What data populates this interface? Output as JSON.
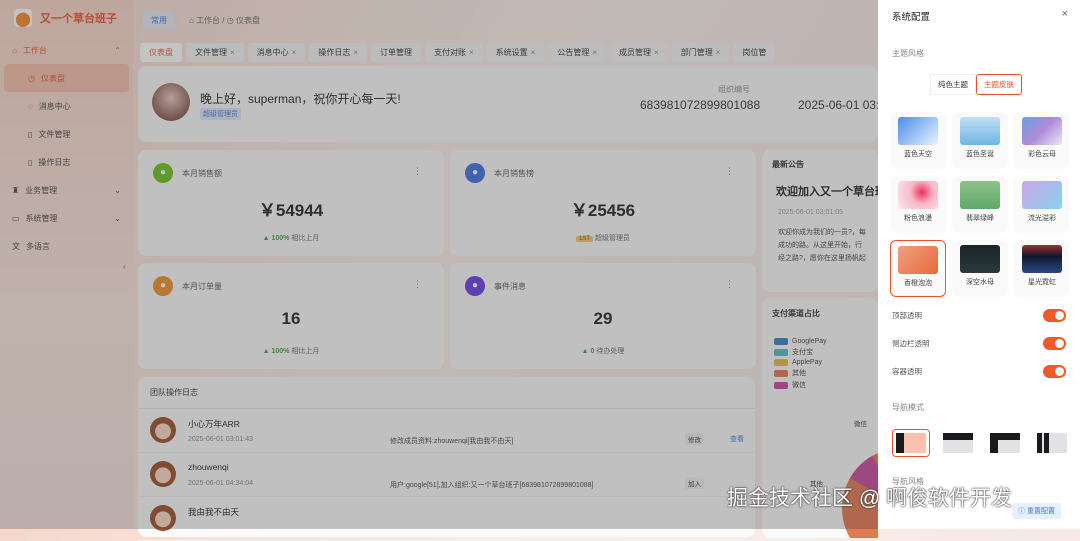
{
  "app": {
    "title": "又一个草台班子"
  },
  "sidebar": {
    "items": [
      {
        "label": "工作台",
        "icon": "home-icon"
      },
      {
        "label": "仪表盘"
      },
      {
        "label": "消息中心"
      },
      {
        "label": "文件管理"
      },
      {
        "label": "操作日志"
      },
      {
        "label": "业务管理"
      },
      {
        "label": "系统管理"
      },
      {
        "label": "多语言"
      }
    ]
  },
  "topbar": {
    "pill": "常用",
    "crumb1": "工作台",
    "sep": "/",
    "crumb2": "仪表盘"
  },
  "tabs": [
    "仪表盘",
    "文件管理",
    "消息中心",
    "操作日志",
    "订单管理",
    "支付对账",
    "系统设置",
    "公告管理",
    "成员管理",
    "部门管理",
    "岗位管"
  ],
  "tab_close": "×",
  "welcome": {
    "greeting": "晚上好，superman，祝你开心每一天!",
    "role": "超级管理员",
    "org_label": "组织编号",
    "org_id": "683981072899801088",
    "date": "2025-06-01 03:0"
  },
  "stats": [
    {
      "label": "本月销售额",
      "value": "￥54944",
      "trend": "▲ 100%",
      "note": "相比上月",
      "color": "#6cc21c"
    },
    {
      "label": "本月销售榜",
      "value": "￥25456",
      "badge": "1ST",
      "note": "超级管理员",
      "color": "#3f6fe0"
    },
    {
      "label": "本月订单量",
      "value": "16",
      "trend": "▲ 100%",
      "note": "相比上月",
      "color": "#f08c2a"
    },
    {
      "label": "事件消息",
      "value": "29",
      "trend": "▲ 0",
      "note": "待办处理",
      "color": "#6a3be0"
    }
  ],
  "more": "⋮",
  "notice": {
    "title": "最新公告",
    "headline": "欢迎加入又一个草台班子",
    "date": "2025-06-01 03:01:05",
    "body": [
      "欢迎你成为我们的一员?，每",
      "成功的路。从这里开始，行",
      "经之路?，愿你在这里扬帆起"
    ]
  },
  "pay": {
    "title": "支付渠道占比",
    "legend": [
      {
        "name": "GooglePay",
        "color": "#3a7fc0"
      },
      {
        "name": "支付宝",
        "color": "#56b9c8"
      },
      {
        "name": "ApplePay",
        "color": "#e6bc3a"
      },
      {
        "name": "其他",
        "color": "#e07850"
      },
      {
        "name": "微信",
        "color": "#c44a9a"
      }
    ],
    "label_wx": "微信",
    "label_other": "其他"
  },
  "log": {
    "title": "团队操作日志",
    "rows": [
      {
        "name": "小心万年ARR",
        "time": "2025-06-01 03:01:43",
        "desc": "修改成员资料:zhouwenqi[我由我不由天]",
        "tag": "修改",
        "link": "查看"
      },
      {
        "name": "zhouwenqi",
        "time": "2025-06-01 04:34:04",
        "desc": "用户:google[51],加入组织:又一个草台班子[683981072899801088]",
        "tag": "加入",
        "link": ""
      },
      {
        "name": "我由我不由天",
        "time": "",
        "desc": "",
        "tag": "",
        "link": ""
      }
    ]
  },
  "drawer": {
    "title": "系统配置",
    "close": "×",
    "theme_section": "主题风格",
    "seg": [
      "纯色主题",
      "主题皮肤"
    ],
    "skins": [
      {
        "name": "蓝色天空",
        "bg": "linear-gradient(135deg,#4a8fe8,#e8f2ff)"
      },
      {
        "name": "蓝色圣诞",
        "bg": "linear-gradient(180deg,#bfe0f5,#6fb5e0)"
      },
      {
        "name": "彩色云母",
        "bg": "linear-gradient(135deg,#6aa0e0,#b08ad8,#e8e8f8)"
      },
      {
        "name": "粉色浪漫",
        "bg": "radial-gradient(circle at 60% 40%,#e8305a,#f8b8c8 40%,#fde8ee)"
      },
      {
        "name": "翡翠绿峰",
        "bg": "linear-gradient(180deg,#8cc28a,#5fa868)"
      },
      {
        "name": "流光溢彩",
        "bg": "linear-gradient(135deg,#c8a8e8,#8ad0f0)"
      },
      {
        "name": "香橙泡泡",
        "bg": "linear-gradient(135deg,#f0a080,#e86a3a)"
      },
      {
        "name": "深空水母",
        "bg": "linear-gradient(180deg,#1a2428,#2a3a3a)"
      },
      {
        "name": "星光霓虹",
        "bg": "linear-gradient(180deg,#a03030,#101830 40%,#2a4880)"
      }
    ],
    "toggles": [
      {
        "label": "顶部透明",
        "on": true
      },
      {
        "label": "侧边栏透明",
        "on": true
      },
      {
        "label": "容器透明",
        "on": true
      }
    ],
    "nav_section": "导航模式",
    "nav_style_section": "导航风格",
    "reset": "重置配置"
  },
  "watermark": "掘金技术社区 @ 啊俊软件开发",
  "colors": {
    "accent": "#e8522d",
    "link": "#4a77d4"
  }
}
